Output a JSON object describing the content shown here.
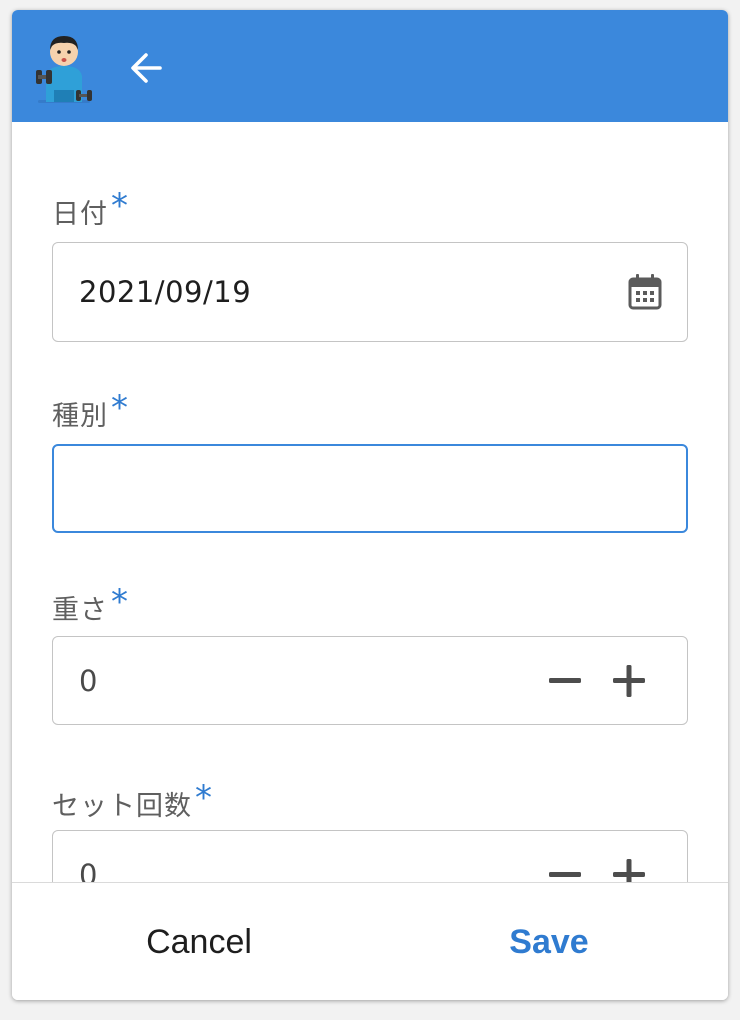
{
  "colors": {
    "header": "#3b88dc",
    "accent": "#2f7bd0",
    "border": "#c4c4c4",
    "focus_border": "#3b88dc"
  },
  "header": {
    "avatar_icon": "dumbbell-man-avatar-icon",
    "back_icon": "arrow-left-icon"
  },
  "form": {
    "required_mark": "*",
    "date": {
      "label": "日付",
      "value": "2021/09/19",
      "icon": "calendar-icon"
    },
    "type": {
      "label": "種別",
      "value": ""
    },
    "weight": {
      "label": "重さ",
      "value": "0",
      "decrement_icon": "minus-icon",
      "increment_icon": "plus-icon"
    },
    "sets": {
      "label": "セット回数",
      "value": "0",
      "decrement_icon": "minus-icon",
      "increment_icon": "plus-icon"
    }
  },
  "footer": {
    "cancel_label": "Cancel",
    "save_label": "Save"
  }
}
